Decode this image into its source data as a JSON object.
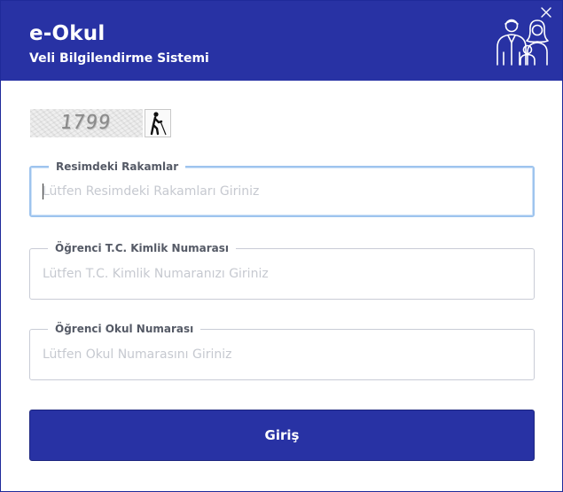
{
  "header": {
    "title": "e-Okul",
    "subtitle": "Veli Bilgilendirme Sistemi",
    "close_icon": "close-icon",
    "illustration_icon": "family-icon",
    "background": "#2832a4"
  },
  "captcha": {
    "text": "1799",
    "audio_icon": "accessibility-walker-icon"
  },
  "form": {
    "captcha_field": {
      "label": "Resimdeki Rakamlar",
      "placeholder": "Lütfen Resimdeki Rakamları Giriniz",
      "value": ""
    },
    "tc_field": {
      "label": "Öğrenci T.C. Kimlik Numarası",
      "placeholder": "Lütfen T.C. Kimlik Numaranızı Giriniz",
      "value": ""
    },
    "school_number_field": {
      "label": "Öğrenci Okul Numarası",
      "placeholder": "Lütfen Okul Numarasını Giriniz",
      "value": ""
    },
    "submit_label": "Giriş"
  }
}
